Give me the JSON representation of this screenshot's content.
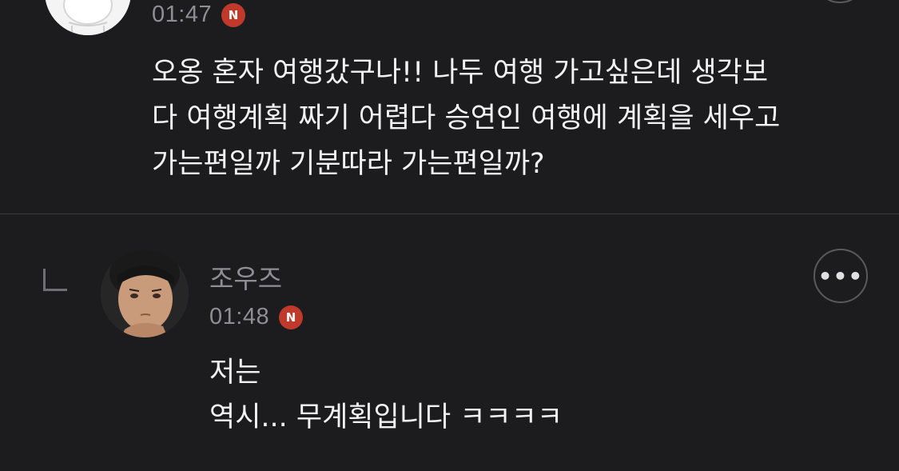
{
  "comment": {
    "time": "01:47",
    "badge": "N",
    "lines": [
      "오옹 혼자 여행갔구나!! 나두 여행 가고싶은데 생각보",
      "다 여행계획 짜기 어렵다 승연인 여행에 계획을 세우고",
      "가는편일까 기분따라 가는편일까?"
    ]
  },
  "reply": {
    "username": "조우즈",
    "time": "01:48",
    "badge": "N",
    "more_label": "•••",
    "lines": [
      "저는",
      "역시... 무계획입니다 ㅋㅋㅋㅋ"
    ]
  },
  "colors": {
    "background": "#1c1c1e",
    "text": "#f2f2f2",
    "muted": "#8e8e93",
    "badge": "#c0392b"
  }
}
